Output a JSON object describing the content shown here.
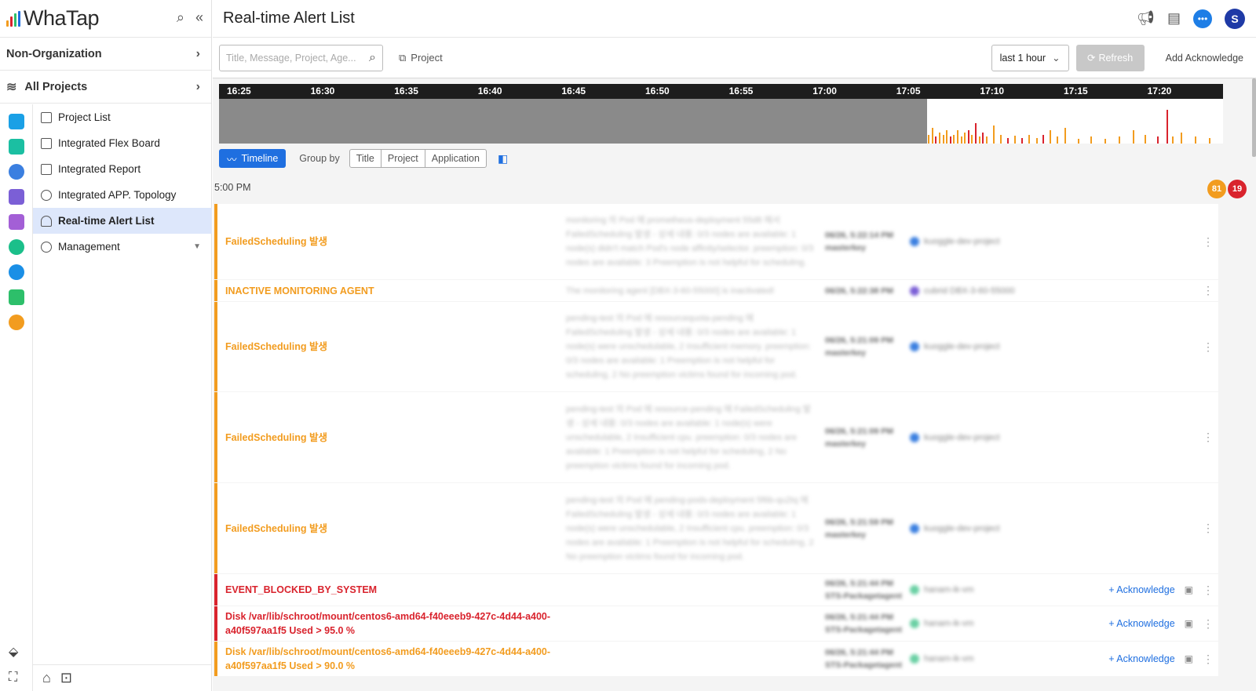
{
  "brand": {
    "name": "WhaTap"
  },
  "sidebar": {
    "org_label": "Non-Organization",
    "projects_label": "All Projects",
    "items": [
      {
        "label": "Project List",
        "icon": "chart-icon"
      },
      {
        "label": "Integrated Flex Board",
        "icon": "grid-icon"
      },
      {
        "label": "Integrated Report",
        "icon": "report-icon"
      },
      {
        "label": "Integrated APP. Topology",
        "icon": "topology-icon"
      },
      {
        "label": "Real-time Alert List",
        "icon": "alarm-icon"
      },
      {
        "label": "Management",
        "icon": "gear-icon"
      }
    ],
    "rail_colors": [
      "#1aa0e6",
      "#1bbfa2",
      "#3b7fe0",
      "#7b5fd6",
      "#a35fd6",
      "#1bbf8a",
      "#1a8fe6",
      "#2dbf6a",
      "#f29c1f"
    ]
  },
  "header": {
    "title": "Real-time Alert List",
    "avatar_initial": "S"
  },
  "filters": {
    "search_placeholder": "Title, Message, Project, Age...",
    "project_label": "Project",
    "time_range": "last 1 hour",
    "refresh_label": "Refresh",
    "add_ack_label": "Add Acknowledge"
  },
  "timeline": {
    "ticks": [
      "16:25",
      "16:30",
      "16:35",
      "16:40",
      "16:45",
      "16:50",
      "16:55",
      "17:00",
      "17:05",
      "17:10",
      "17:15",
      "17:20"
    ],
    "colors": {
      "warning": "#f29c1f",
      "critical": "#d9232d"
    },
    "bars": [
      {
        "t": 0.706,
        "v": 0.2,
        "c": "warning"
      },
      {
        "t": 0.71,
        "v": 0.35,
        "c": "warning"
      },
      {
        "t": 0.713,
        "v": 0.15,
        "c": "critical"
      },
      {
        "t": 0.717,
        "v": 0.25,
        "c": "warning"
      },
      {
        "t": 0.721,
        "v": 0.2,
        "c": "warning"
      },
      {
        "t": 0.724,
        "v": 0.3,
        "c": "warning"
      },
      {
        "t": 0.728,
        "v": 0.15,
        "c": "critical"
      },
      {
        "t": 0.731,
        "v": 0.2,
        "c": "warning"
      },
      {
        "t": 0.735,
        "v": 0.3,
        "c": "warning"
      },
      {
        "t": 0.739,
        "v": 0.15,
        "c": "warning"
      },
      {
        "t": 0.742,
        "v": 0.25,
        "c": "warning"
      },
      {
        "t": 0.746,
        "v": 0.3,
        "c": "critical"
      },
      {
        "t": 0.749,
        "v": 0.2,
        "c": "warning"
      },
      {
        "t": 0.753,
        "v": 0.45,
        "c": "critical"
      },
      {
        "t": 0.757,
        "v": 0.15,
        "c": "warning"
      },
      {
        "t": 0.76,
        "v": 0.25,
        "c": "critical"
      },
      {
        "t": 0.764,
        "v": 0.15,
        "c": "warning"
      },
      {
        "t": 0.771,
        "v": 0.4,
        "c": "warning"
      },
      {
        "t": 0.778,
        "v": 0.2,
        "c": "warning"
      },
      {
        "t": 0.785,
        "v": 0.12,
        "c": "critical"
      },
      {
        "t": 0.792,
        "v": 0.18,
        "c": "warning"
      },
      {
        "t": 0.799,
        "v": 0.12,
        "c": "critical"
      },
      {
        "t": 0.806,
        "v": 0.2,
        "c": "warning"
      },
      {
        "t": 0.814,
        "v": 0.12,
        "c": "warning"
      },
      {
        "t": 0.82,
        "v": 0.2,
        "c": "critical"
      },
      {
        "t": 0.827,
        "v": 0.3,
        "c": "warning"
      },
      {
        "t": 0.834,
        "v": 0.15,
        "c": "warning"
      },
      {
        "t": 0.842,
        "v": 0.35,
        "c": "warning"
      },
      {
        "t": 0.855,
        "v": 0.1,
        "c": "warning"
      },
      {
        "t": 0.868,
        "v": 0.15,
        "c": "warning"
      },
      {
        "t": 0.882,
        "v": 0.1,
        "c": "warning"
      },
      {
        "t": 0.896,
        "v": 0.15,
        "c": "warning"
      },
      {
        "t": 0.91,
        "v": 0.3,
        "c": "warning"
      },
      {
        "t": 0.922,
        "v": 0.2,
        "c": "warning"
      },
      {
        "t": 0.934,
        "v": 0.15,
        "c": "critical"
      },
      {
        "t": 0.944,
        "v": 0.75,
        "c": "critical"
      },
      {
        "t": 0.949,
        "v": 0.15,
        "c": "warning"
      },
      {
        "t": 0.958,
        "v": 0.25,
        "c": "warning"
      },
      {
        "t": 0.972,
        "v": 0.15,
        "c": "warning"
      },
      {
        "t": 0.986,
        "v": 0.12,
        "c": "warning"
      }
    ]
  },
  "controls": {
    "timeline_label": "Timeline",
    "group_by_label": "Group by",
    "group_options": [
      "Title",
      "Project",
      "Application"
    ]
  },
  "group": {
    "time_label": "5:00 PM",
    "warning_count": "81",
    "critical_count": "19"
  },
  "alerts": [
    {
      "level": "warning",
      "h": 96,
      "title": "FailedScheduling 발생",
      "message": "monitoring 의 Pod 에 prometheus-deployment 55d8 에서 FailedScheduling 발생 - 상세 내용: 0/3 nodes are available: 1 node(s) didn't match Pod's node affinity/selector. preemption: 0/3 nodes are available: 3 Preemption is not helpful for scheduling.",
      "time": "06/26, 5:22:14 PM",
      "sub": "masterkey",
      "project": "kuoggle-dev-project",
      "dot": "#3b7fe0",
      "ack": ""
    },
    {
      "level": "warning",
      "h": 27,
      "title": "INACTIVE MONITORING AGENT",
      "message": "The monitoring agent [DBX-3-60-55000] is inactivated!",
      "time": "06/26, 5:22:38 PM",
      "sub": "",
      "project": "cubrid    DBX-3-60-55000",
      "dot": "#7b5fd6",
      "ack": ""
    },
    {
      "level": "warning",
      "h": 114,
      "title": "FailedScheduling 발생",
      "message": "pending-test 의 Pod 에 resourcequota-pending 에 FailedScheduling 발생 - 상세 내용: 0/3 nodes are available: 1 node(s) were unschedulable, 2 Insufficient memory. preemption: 0/3 nodes are available: 1 Preemption is not helpful for scheduling, 2 No preemption victims found for incoming pod.",
      "time": "06/26, 5:21:09 PM",
      "sub": "masterkey",
      "project": "kuoggle-dev-project",
      "dot": "#3b7fe0",
      "ack": ""
    },
    {
      "level": "warning",
      "h": 115,
      "title": "FailedScheduling 발생",
      "message": "pending-test 의 Pod 에 resource-pending 에 FailedScheduling 발생 - 상세 내용: 0/3 nodes are available: 1 node(s) were unschedulable, 2 Insufficient cpu. preemption: 0/3 nodes are available: 1 Preemption is not helpful for scheduling, 2 No preemption victims found for incoming pod.",
      "time": "06/26, 5:21:09 PM",
      "sub": "masterkey",
      "project": "kuoggle-dev-project",
      "dot": "#3b7fe0",
      "ack": ""
    },
    {
      "level": "warning",
      "h": 115,
      "title": "FailedScheduling 발생",
      "message": "pending-test 의 Pod 에 pending-pods-deployment 5f6b-qu2tq 에 FailedScheduling 발생 - 상세 내용: 0/3 nodes are available: 1 node(s) were unschedulable, 2 Insufficient cpu. preemption: 0/3 nodes are available: 1 Preemption is not helpful for scheduling, 2 No preemption victims found for incoming pod.",
      "time": "06/26, 5:21:59 PM",
      "sub": "masterkey",
      "project": "kuoggle-dev-project",
      "dot": "#3b7fe0",
      "ack": ""
    },
    {
      "level": "critical",
      "h": 40,
      "title": "EVENT_BLOCKED_BY_SYSTEM",
      "message": "",
      "time": "06/26, 5:21:44 PM",
      "sub": "STS-Packagetagent",
      "project": "hanam-ik-vm",
      "dot": "#6ad0a4",
      "ack": "+ Acknowledge"
    },
    {
      "level": "critical",
      "h": 44,
      "title": "Disk /var/lib/schroot/mount/centos6-amd64-f40eeeb9-427c-4d44-a400-a40f597aa1f5 Used > 95.0 %",
      "message": "",
      "time": "06/26, 5:21:44 PM",
      "sub": "STS-Packagetagent",
      "project": "hanam-ik-vm",
      "dot": "#6ad0a4",
      "ack": "+ Acknowledge"
    },
    {
      "level": "warning",
      "h": 44,
      "title": "Disk /var/lib/schroot/mount/centos6-amd64-f40eeeb9-427c-4d44-a400-a40f597aa1f5 Used > 90.0 %",
      "message": "",
      "time": "06/26, 5:21:44 PM",
      "sub": "STS-Packagetagent",
      "project": "hanam-ik-vm",
      "dot": "#6ad0a4",
      "ack": "+ Acknowledge"
    }
  ]
}
